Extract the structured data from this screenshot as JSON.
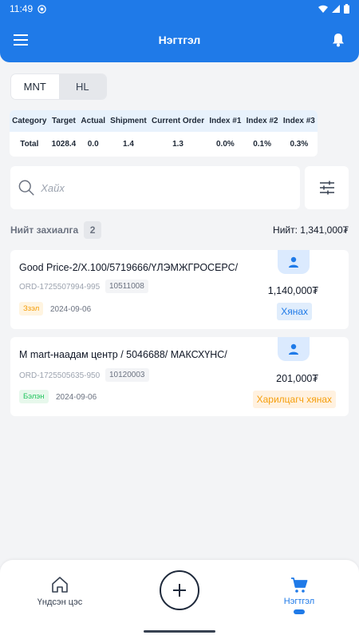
{
  "status_bar": {
    "time": "11:49"
  },
  "header": {
    "title": "Нэгтгэл"
  },
  "currency_toggle": {
    "options": [
      "MNT",
      "HL"
    ],
    "selected": "MNT"
  },
  "summary_table": {
    "headers": [
      "Category",
      "Target",
      "Actual",
      "Shipment",
      "Current Order",
      "Index #1",
      "Index #2",
      "Index #3"
    ],
    "rows": [
      [
        "Total",
        "1028.4",
        "0.0",
        "1.4",
        "1.3",
        "0.0%",
        "0.1%",
        "0.3%"
      ]
    ]
  },
  "search": {
    "placeholder": "Хайх"
  },
  "orders_header": {
    "label": "Нийт захиалга",
    "count": "2",
    "total": "Нийт: 1,341,000₮"
  },
  "orders": [
    {
      "title": "Good Price-2/Х.100/5719666/ҮЛЭМЖГРОСЕРС/",
      "order_id": "ORD-1725507994-995",
      "code": "10511008",
      "status": "Ззэл",
      "date": "2024-09-06",
      "amount": "1,140,000₮",
      "action": "Хянах"
    },
    {
      "title": "M mart-наадам центр / 5046688/ МАКСХҮНС/",
      "order_id": "ORD-1725505635-950",
      "code": "10120003",
      "status": "Бэлэн",
      "date": "2024-09-06",
      "amount": "201,000₮",
      "action": "Харилцагч хянах"
    }
  ],
  "bottom_nav": {
    "home_label": "Үндсэн цэс",
    "orders_label": "Нэгтгэл"
  },
  "colors": {
    "primary": "#1f7ae8",
    "draft": "#f59e0b",
    "ready": "#22c55e"
  }
}
